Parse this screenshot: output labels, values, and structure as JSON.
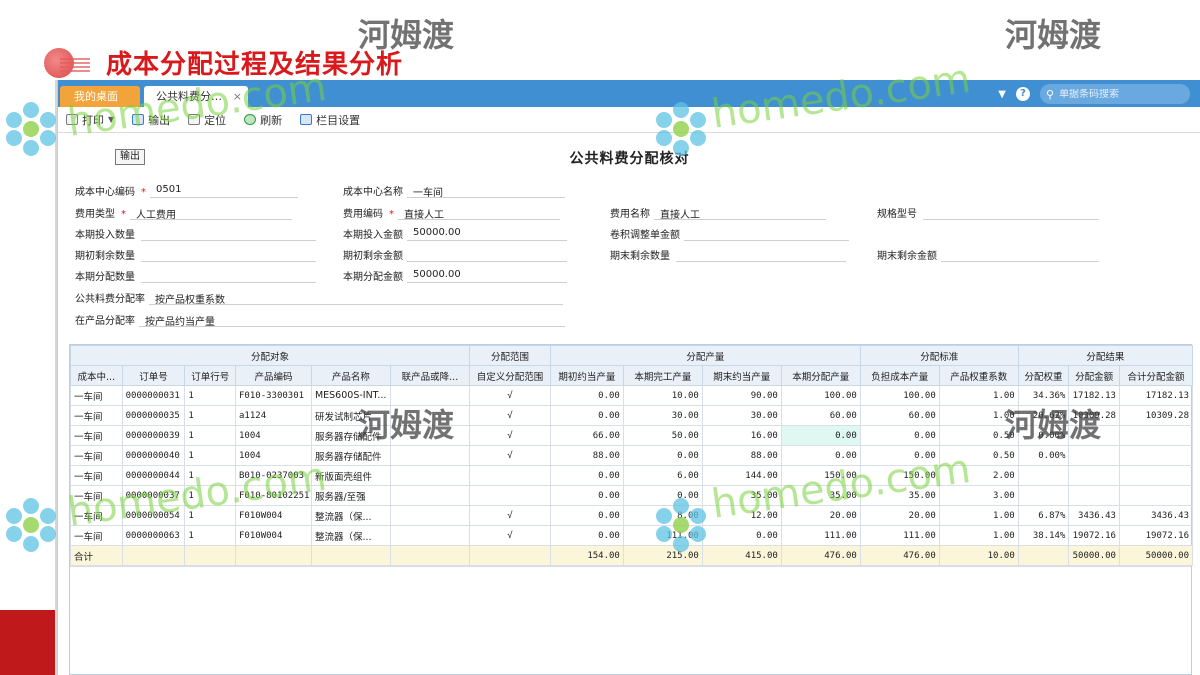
{
  "slide": {
    "title": "成本分配过程及结果分析"
  },
  "tabs": {
    "home": "我的桌面",
    "active": "公共料费分…",
    "close": "×"
  },
  "search": {
    "placeholder": "单据条码搜索"
  },
  "toolbar": {
    "print": "打印",
    "export": "输出",
    "locate": "定位",
    "refresh": "刷新",
    "columns": "栏目设置"
  },
  "form": {
    "title": "公共料费分配核对",
    "export_button": "输出",
    "cost_center_code_label": "成本中心编码",
    "cost_center_code": "0501",
    "cost_center_name_label": "成本中心名称",
    "cost_center_name": "一车间",
    "expense_type_label": "费用类型",
    "expense_type": "人工费用",
    "expense_code_label": "费用编码",
    "expense_code": "直接人工",
    "expense_name_label": "费用名称",
    "expense_name": "直接人工",
    "spec_label": "规格型号",
    "spec": "",
    "input_qty_label": "本期投入数量",
    "input_qty": "",
    "input_amt_label": "本期投入金额",
    "input_amt": "50000.00",
    "roll_adj_label": "卷积调整单金额",
    "roll_adj": "",
    "open_qty_label": "期初剩余数量",
    "open_qty": "",
    "open_amt_label": "期初剩余金额",
    "open_amt": "",
    "close_qty_label": "期末剩余数量",
    "close_qty": "",
    "close_amt_label": "期末剩余金额",
    "close_amt": "",
    "alloc_qty_label": "本期分配数量",
    "alloc_qty": "",
    "alloc_amt_label": "本期分配金额",
    "alloc_amt": "50000.00",
    "public_rate_label": "公共料费分配率",
    "public_rate": "按产品权重系数",
    "wip_rate_label": "在产品分配率",
    "wip_rate": "按产品约当产量"
  },
  "grid": {
    "groups": [
      "分配对象",
      "分配范围",
      "分配产量",
      "分配标准",
      "分配结果"
    ],
    "columns": [
      "成本中...",
      "订单号",
      "订单行号",
      "产品编码",
      "产品名称",
      "联产品或降...",
      "自定义分配范围",
      "期初约当产量",
      "本期完工产量",
      "期末约当产量",
      "本期分配产量",
      "负担成本产量",
      "产品权重系数",
      "分配权重",
      "分配金额",
      "合计分配金额"
    ],
    "rows": [
      [
        "一车间",
        "0000000031",
        "1",
        "F010-3300301",
        "MES600S-INT...",
        "",
        "√",
        "0.00",
        "10.00",
        "90.00",
        "100.00",
        "100.00",
        "1.00",
        "34.36%",
        "17182.13",
        "17182.13"
      ],
      [
        "一车间",
        "0000000035",
        "1",
        "a1124",
        "研发试制芯片",
        "",
        "√",
        "0.00",
        "30.00",
        "30.00",
        "60.00",
        "60.00",
        "1.00",
        "20.62%",
        "10309.28",
        "10309.28"
      ],
      [
        "一车间",
        "0000000039",
        "1",
        "1004",
        "服务器存储配件",
        "",
        "√",
        "66.00",
        "50.00",
        "16.00",
        "0.00",
        "0.00",
        "0.50",
        "0.00%",
        "",
        ""
      ],
      [
        "一车间",
        "0000000040",
        "1",
        "1004",
        "服务器存储配件",
        "",
        "√",
        "88.00",
        "0.00",
        "88.00",
        "0.00",
        "0.00",
        "0.50",
        "0.00%",
        "",
        ""
      ],
      [
        "一车间",
        "0000000044",
        "1",
        "B010-0237003",
        "新版面壳组件",
        "",
        "",
        "0.00",
        "6.00",
        "144.00",
        "150.00",
        "150.00",
        "2.00",
        "",
        "",
        ""
      ],
      [
        "一车间",
        "0000000037",
        "1",
        "F010-80102251",
        "服务器/至强",
        "",
        "",
        "0.00",
        "0.00",
        "35.00",
        "35.00",
        "35.00",
        "3.00",
        "",
        "",
        ""
      ],
      [
        "一车间",
        "0000000054",
        "1",
        "F010W004",
        "整流器（保...",
        "",
        "√",
        "0.00",
        "8.00",
        "12.00",
        "20.00",
        "20.00",
        "1.00",
        "6.87%",
        "3436.43",
        "3436.43"
      ],
      [
        "一车间",
        "0000000063",
        "1",
        "F010W004",
        "整流器（保...",
        "",
        "√",
        "0.00",
        "111.00",
        "0.00",
        "111.00",
        "111.00",
        "1.00",
        "38.14%",
        "19072.16",
        "19072.16"
      ]
    ],
    "total": [
      "合计",
      "",
      "",
      "",
      "",
      "",
      "",
      "154.00",
      "215.00",
      "415.00",
      "476.00",
      "476.00",
      "10.00",
      "",
      "50000.00",
      "50000.00"
    ]
  },
  "watermark": {
    "cn": "河姆渡",
    "en": "homedo.com"
  }
}
